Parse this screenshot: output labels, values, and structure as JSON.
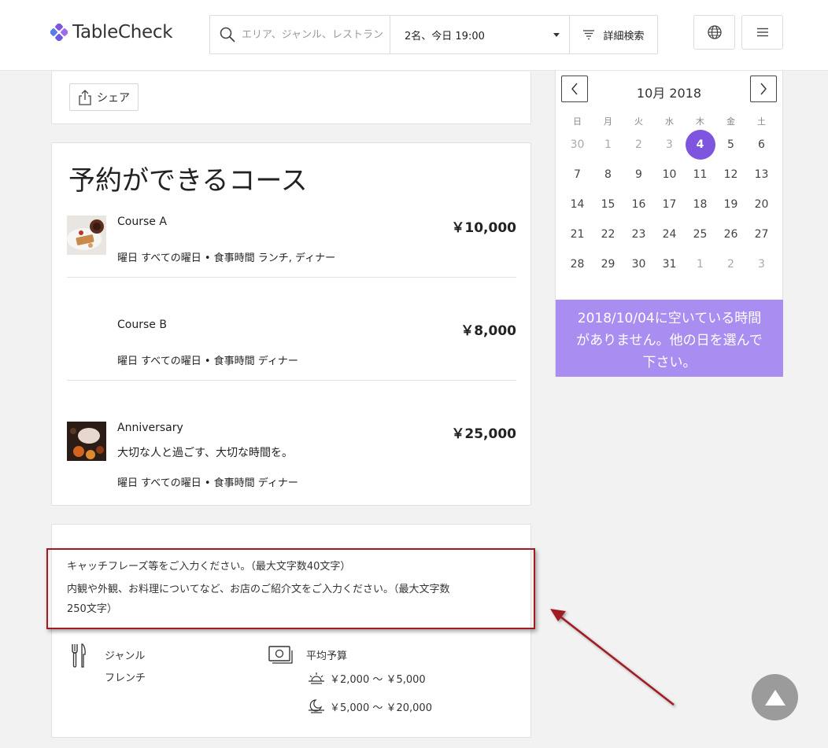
{
  "header": {
    "logo_text": "TableCheck",
    "search_placeholder": "エリア、ジャンル、レストラン名",
    "party_label": "2名、今日 19:00",
    "advanced_search": "詳細検索"
  },
  "share": {
    "label": "シェア"
  },
  "courses": {
    "title": "予約ができるコース",
    "items": [
      {
        "name": "Course A",
        "price": "￥10,000",
        "description": "",
        "meta": "曜日 すべての曜日 • 食事時間 ランチ, ディナー"
      },
      {
        "name": "Course B",
        "price": "￥8,000",
        "description": "",
        "meta": "曜日 すべての曜日 • 食事時間 ディナー"
      },
      {
        "name": "Anniversary",
        "price": "￥25,000",
        "description": "大切な人と過ごす、大切な時間を。",
        "meta": "曜日 すべての曜日 • 食事時間 ディナー"
      }
    ]
  },
  "info": {
    "catchphrase": "キャッチフレーズ等をご入力ください。（最大文字数40文字）",
    "intro_line1": "内観や外観、お料理についてなど、お店のご紹介文をご入力ください。（最大文字数",
    "intro_line2": "250文字）",
    "genre_label": "ジャンル",
    "genre_value": "フレンチ",
    "budget_label": "平均予算",
    "budget_lunch": "￥2,000 ～ ￥5,000",
    "budget_dinner": "￥5,000 ～ ￥20,000"
  },
  "calendar": {
    "month_label": "10月 2018",
    "weekdays": [
      "日",
      "月",
      "火",
      "水",
      "木",
      "金",
      "土"
    ],
    "weeks": [
      [
        "30",
        "1",
        "2",
        "3",
        "4",
        "5",
        "6"
      ],
      [
        "7",
        "8",
        "9",
        "10",
        "11",
        "12",
        "13"
      ],
      [
        "14",
        "15",
        "16",
        "17",
        "18",
        "19",
        "20"
      ],
      [
        "21",
        "22",
        "23",
        "24",
        "25",
        "26",
        "27"
      ],
      [
        "28",
        "29",
        "30",
        "31",
        "1",
        "2",
        "3"
      ]
    ],
    "selected_day": "4",
    "message": "2018/10/04に空いている時間がありません。他の日を選んで下さい。"
  },
  "colors": {
    "accent": "#7f55e0",
    "message_bg": "#a98df0",
    "annotation": "#a01c22"
  }
}
